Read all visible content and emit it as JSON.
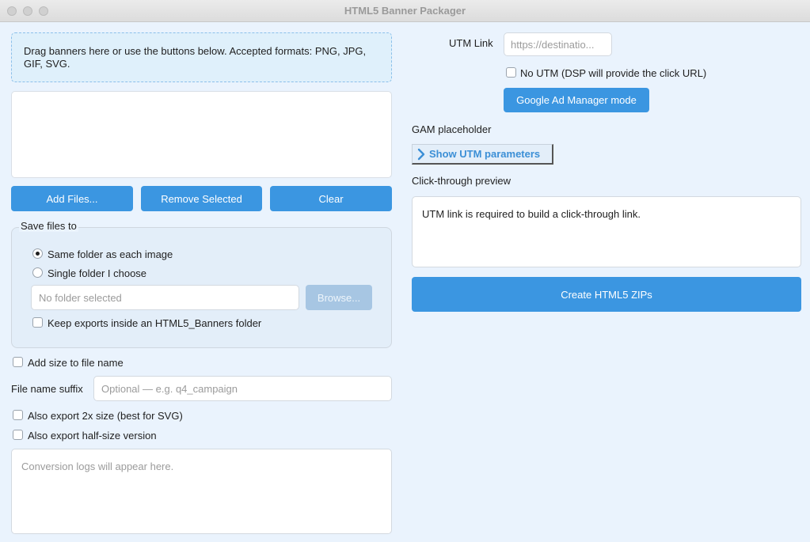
{
  "window": {
    "title": "HTML5 Banner Packager"
  },
  "dropzone": {
    "text": "Drag banners here or use the buttons below. Accepted formats: PNG, JPG, GIF, SVG."
  },
  "file_buttons": {
    "add": "Add Files...",
    "remove": "Remove Selected",
    "clear": "Clear"
  },
  "save": {
    "group_label": "Save files to",
    "same_folder": "Same folder as each image",
    "single_folder": "Single folder I choose",
    "selected": "same_folder",
    "folder_placeholder": "No folder selected",
    "browse": "Browse...",
    "keep_inside": "Keep exports inside an HTML5_Banners folder"
  },
  "options": {
    "add_size": "Add size to file name",
    "suffix_label": "File name suffix",
    "suffix_placeholder": "Optional — e.g. q4_campaign",
    "export_2x": "Also export 2x size (best for SVG)",
    "export_half": "Also export half-size version"
  },
  "log": {
    "placeholder": "Conversion logs will appear here."
  },
  "utm": {
    "label": "UTM Link",
    "placeholder": "https://destinatio...",
    "no_utm": "No UTM (DSP will provide the click URL)",
    "gam_button": "Google Ad Manager mode",
    "gam_placeholder": "GAM placeholder",
    "show_params": "Show UTM parameters"
  },
  "preview": {
    "label": "Click-through preview",
    "text": "UTM link is required to build a click-through link."
  },
  "create_button": "Create HTML5 ZIPs",
  "colors": {
    "accent": "#3b96e1",
    "background": "#eaf3fd"
  }
}
